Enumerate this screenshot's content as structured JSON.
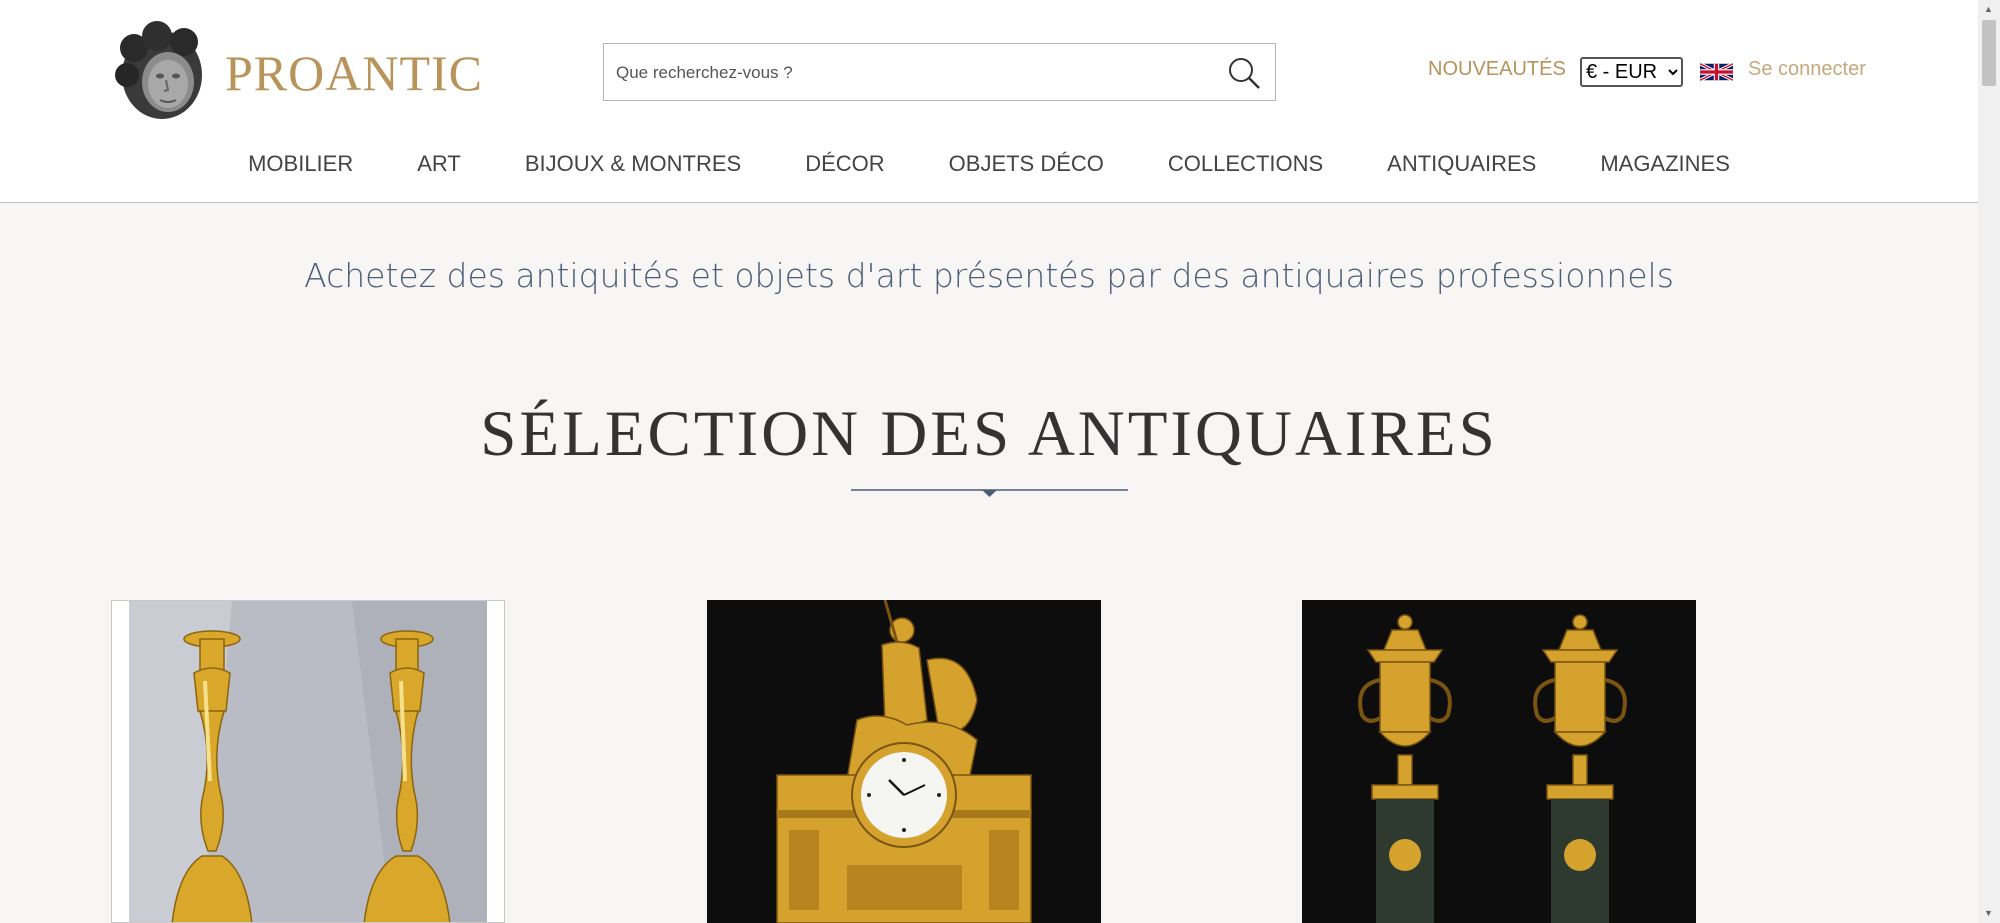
{
  "header": {
    "brand": "PROANTIC",
    "search": {
      "placeholder": "Que recherchez-vous ?"
    },
    "nouveautes": "NOUVEAUTÉS",
    "currency": {
      "selected": "€ - EUR"
    },
    "login": "Se connecter",
    "icons": {
      "logo": "cherub-head-logo",
      "search": "search-icon",
      "flag": "uk-flag-icon"
    }
  },
  "nav": {
    "items": [
      {
        "label": "MOBILIER"
      },
      {
        "label": "ART"
      },
      {
        "label": "BIJOUX & MONTRES"
      },
      {
        "label": "DÉCOR"
      },
      {
        "label": "OBJETS DÉCO"
      },
      {
        "label": "COLLECTIONS"
      },
      {
        "label": "ANTIQUAIRES"
      },
      {
        "label": "MAGAZINES"
      }
    ]
  },
  "main": {
    "tagline": "Achetez des antiquités et objets d'art présentés par des antiquaires professionnels",
    "section_title": "SÉLECTION DES ANTIQUAIRES",
    "products": [
      {
        "image": "gilt-bronze-candlesticks-pair"
      },
      {
        "image": "empire-gilt-bronze-mantel-clock"
      },
      {
        "image": "gilt-bronze-cassolettes-pair"
      }
    ]
  },
  "colors": {
    "accent_gold": "#b8935a",
    "tagline_blue": "#4b5d77",
    "page_bg": "#f7f6f4",
    "nav_text": "#444444"
  }
}
